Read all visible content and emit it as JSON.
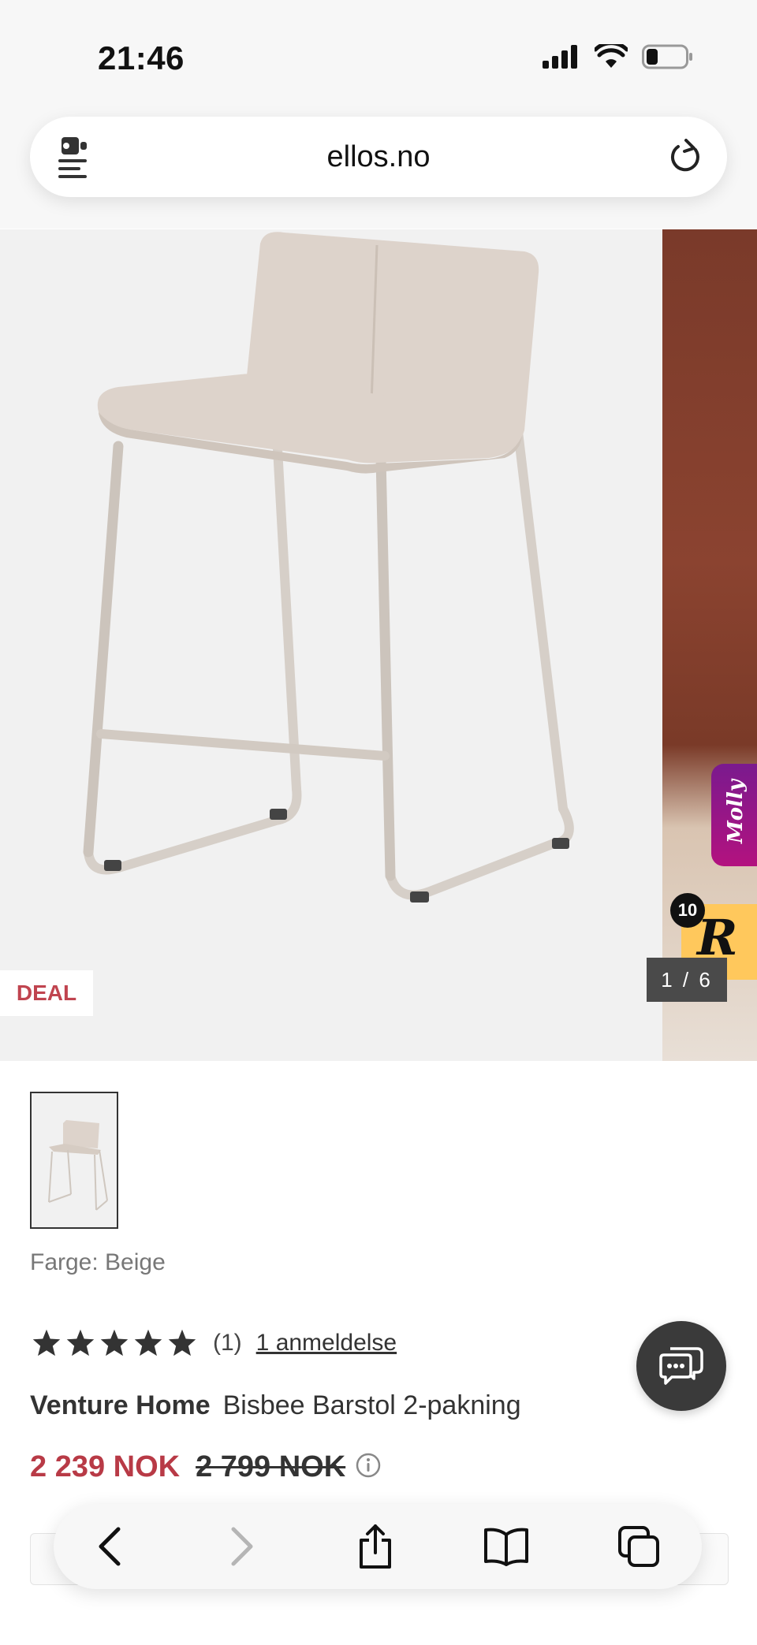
{
  "status_bar": {
    "time": "21:46",
    "icons": [
      "signal-icon",
      "wifi-icon",
      "battery-icon"
    ]
  },
  "browser": {
    "url": "ellos.no",
    "left_icon": "page-menu-icon",
    "reload_icon": "reload-icon"
  },
  "gallery": {
    "badge": "DEAL",
    "counter": "1 / 6",
    "side_tabs": {
      "molly_label": "Molly",
      "r_label": "R",
      "r_badge": "10"
    }
  },
  "product": {
    "color_label": "Farge: Beige",
    "rating": 5,
    "review_count": "(1)",
    "review_link": "1 anmeldelse",
    "brand": "Venture Home",
    "name": "Bisbee Barstol 2-pakning",
    "price_now": "2 239 NOK",
    "price_old": "2 799 NOK"
  },
  "toolbar": {
    "buttons": [
      "back-icon",
      "forward-icon",
      "share-icon",
      "bookmarks-icon",
      "tabs-icon"
    ]
  },
  "colors": {
    "sale": "#b83a46",
    "chat_button": "#3a3a3a",
    "molly": "#9a1488",
    "r_tab": "#ffc85c"
  }
}
